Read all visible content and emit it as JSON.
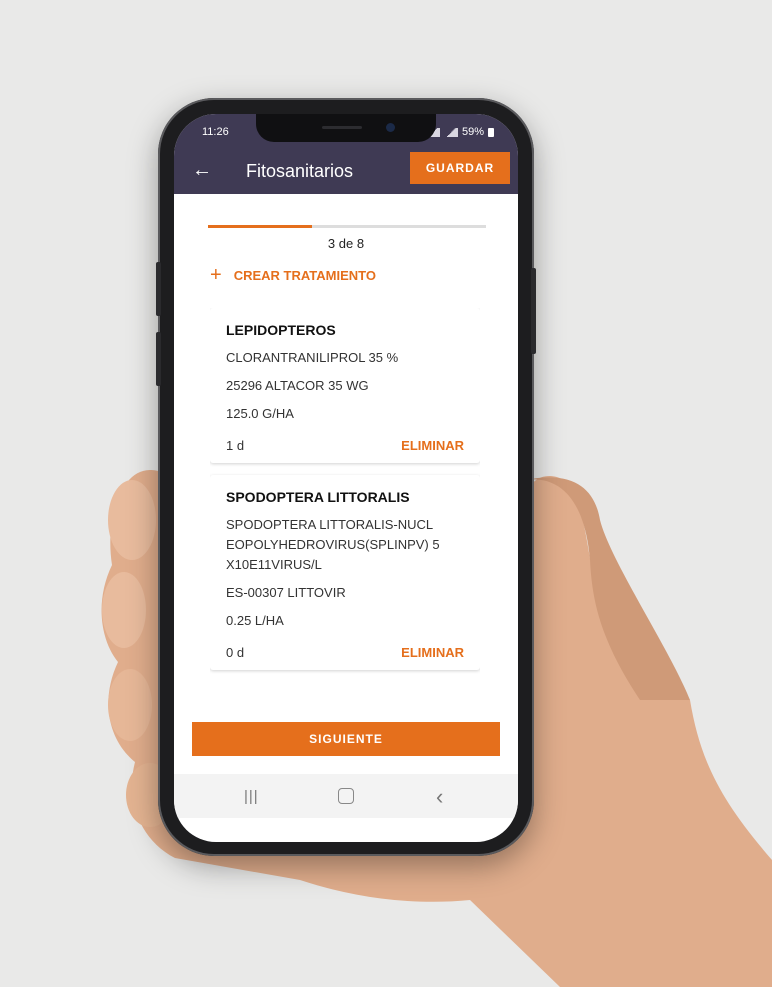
{
  "status": {
    "time": "11:26",
    "battery": "59%"
  },
  "header": {
    "title": "Fitosanitarios",
    "back_icon": "arrow-left-icon",
    "save_label": "GUARDAR"
  },
  "progress": {
    "fraction": 0.375,
    "label": "3 de 8"
  },
  "create_treatment": {
    "icon": "plus-icon",
    "label": "CREAR TRATAMIENTO"
  },
  "treatments": [
    {
      "pest": "LEPIDOPTEROS",
      "active_ingredient": "CLORANTRANILIPROL 35 %",
      "product": "25296 ALTACOR 35 WG",
      "dose": "125.0 G/HA",
      "days": "1 d",
      "delete_label": "ELIMINAR"
    },
    {
      "pest": "SPODOPTERA LITTORALIS",
      "active_ingredient": "SPODOPTERA LITTORALIS-NUCL EOPOLYHEDROVIRUS(SPLINPV) 5 X10E11VIRUS/L",
      "product": "ES-00307 LITTOVIR",
      "dose": "0.25 L/HA",
      "days": "0 d",
      "delete_label": "ELIMINAR"
    }
  ],
  "next_label": "SIGUIENTE",
  "colors": {
    "accent": "#e56f1c",
    "appbar": "#3f3a54"
  }
}
